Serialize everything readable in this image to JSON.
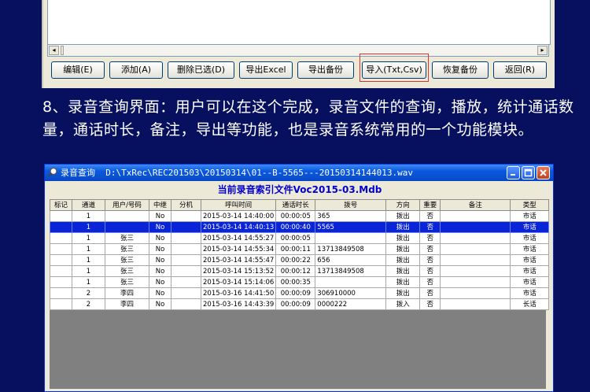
{
  "toolbar": {
    "buttons": [
      {
        "label": "编辑(E)"
      },
      {
        "label": "添加(A)"
      },
      {
        "label": "删除已选(D)"
      },
      {
        "label": "导出Excel"
      },
      {
        "label": "导出备份"
      },
      {
        "label": "导入(Txt,Csv)"
      },
      {
        "label": "恢复备份"
      },
      {
        "label": "返回(R)"
      }
    ],
    "highlight_color": "#e03030"
  },
  "description": "8、录音查询界面：用户可以在这个完成，录音文件的查询，播放，统计通话数量，通话时长，备注，导出等功能，也是录音系统常用的一个功能模块。",
  "window": {
    "title": "录音查询",
    "path": "D:\\TxRec\\REC201503\\20150314\\01--B-5565---20150314144013.wav",
    "icon": "search-icon"
  },
  "grid": {
    "title": "当前录音索引文件Voc2015-03.Mdb",
    "headers": [
      "标记",
      "通道",
      "用户/号码",
      "中继",
      "分机",
      "呼叫时间",
      "通话时长",
      "拨号",
      "方向",
      "重要",
      "备注",
      "类型"
    ],
    "rows": [
      {
        "mark": "",
        "channel": "1",
        "user": "",
        "trunk": "No",
        "ext": "",
        "call_time": "2015-03-14 14:40:00",
        "duration": "00:00:05",
        "dial": "365",
        "direction": "拨出",
        "important": "否",
        "note": "",
        "type": "市话"
      },
      {
        "mark": "",
        "channel": "1",
        "user": "",
        "trunk": "No",
        "ext": "",
        "call_time": "2015-03-14 14:40:13",
        "duration": "00:00:40",
        "dial": "5565",
        "direction": "拨出",
        "important": "否",
        "note": "",
        "type": "市话"
      },
      {
        "mark": "",
        "channel": "1",
        "user": "张三",
        "trunk": "No",
        "ext": "",
        "call_time": "2015-03-14 14:55:27",
        "duration": "00:00:05",
        "dial": "",
        "direction": "拨出",
        "important": "否",
        "note": "",
        "type": "市话"
      },
      {
        "mark": "",
        "channel": "1",
        "user": "张三",
        "trunk": "No",
        "ext": "",
        "call_time": "2015-03-14 14:55:34",
        "duration": "00:00:11",
        "dial": "13713849508",
        "direction": "拨出",
        "important": "否",
        "note": "",
        "type": "市话"
      },
      {
        "mark": "",
        "channel": "1",
        "user": "张三",
        "trunk": "No",
        "ext": "",
        "call_time": "2015-03-14 14:55:47",
        "duration": "00:00:22",
        "dial": "656",
        "direction": "拨出",
        "important": "否",
        "note": "",
        "type": "市话"
      },
      {
        "mark": "",
        "channel": "1",
        "user": "张三",
        "trunk": "No",
        "ext": "",
        "call_time": "2015-03-14 15:13:52",
        "duration": "00:00:12",
        "dial": "13713849508",
        "direction": "拨出",
        "important": "否",
        "note": "",
        "type": "市话"
      },
      {
        "mark": "",
        "channel": "1",
        "user": "张三",
        "trunk": "No",
        "ext": "",
        "call_time": "2015-03-14 15:14:06",
        "duration": "00:00:35",
        "dial": "",
        "direction": "拨出",
        "important": "否",
        "note": "",
        "type": "市话"
      },
      {
        "mark": "",
        "channel": "2",
        "user": "李四",
        "trunk": "No",
        "ext": "",
        "call_time": "2015-03-16 14:41:50",
        "duration": "00:00:09",
        "dial": "306910000",
        "direction": "拨出",
        "important": "否",
        "note": "",
        "type": "市话"
      },
      {
        "mark": "",
        "channel": "2",
        "user": "李四",
        "trunk": "No",
        "ext": "",
        "call_time": "2015-03-16 14:43:39",
        "duration": "00:00:09",
        "dial": "0000222",
        "direction": "拨入",
        "important": "否",
        "note": "",
        "type": "长话"
      }
    ],
    "selected_row": 1
  },
  "colors": {
    "page_background": "#07105e",
    "selection": "#0a24d8",
    "grid_title": "#0000d0"
  }
}
